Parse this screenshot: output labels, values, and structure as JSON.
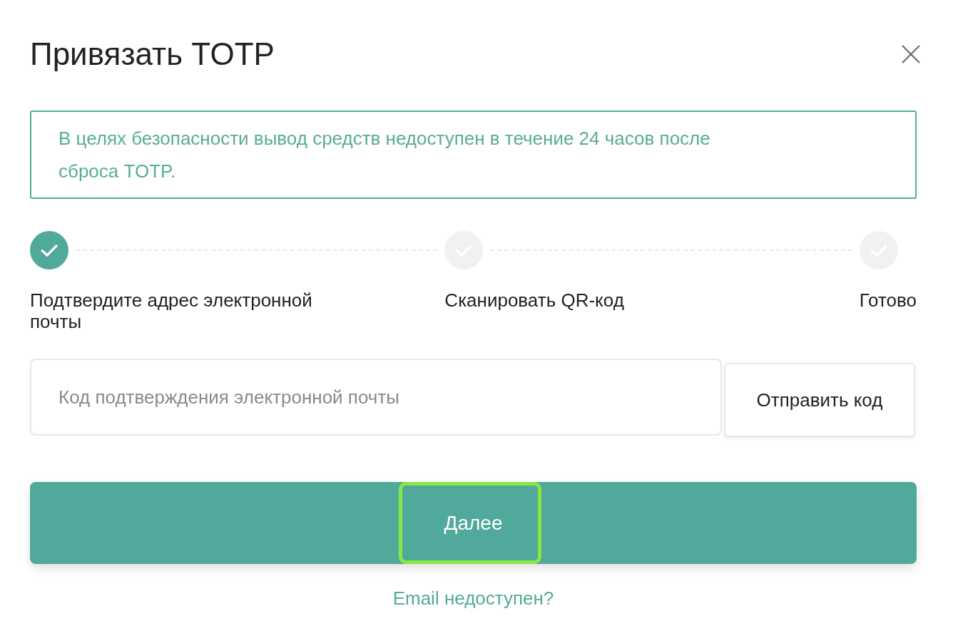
{
  "dialog": {
    "title": "Привязать TOTP"
  },
  "alert": {
    "text": "В целях безопасности вывод средств недоступен в течение 24 часов после сброса TOTP."
  },
  "steps": [
    {
      "label": "Подтвердите адрес электронной почты",
      "done": true
    },
    {
      "label": "Сканировать QR-код",
      "done": false
    },
    {
      "label": "Готово",
      "done": false
    }
  ],
  "code_field": {
    "placeholder": "Код подтверждения электронной почты"
  },
  "send_code_button": {
    "label": "Отправить код"
  },
  "next_button": {
    "label": "Далее",
    "highlighted": true
  },
  "email_unavailable_link": {
    "label": "Email недоступен?"
  }
}
